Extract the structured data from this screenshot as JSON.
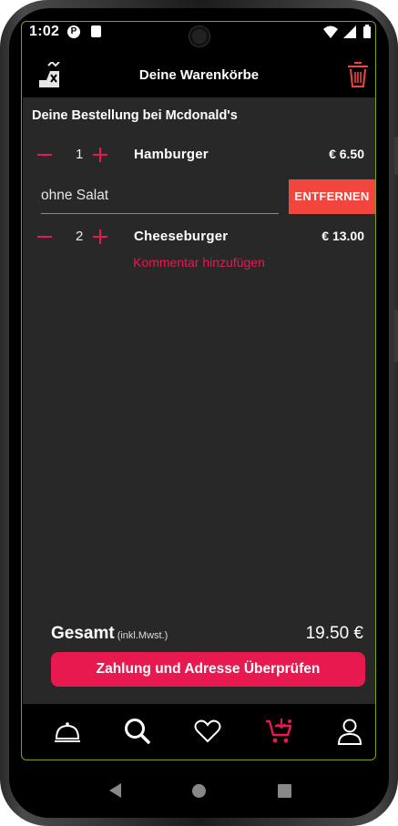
{
  "status_bar": {
    "time": "1:02"
  },
  "header": {
    "title": "Deine Warenkörbe"
  },
  "order": {
    "restaurant_title": "Deine Bestellung bei Mcdonald's",
    "items": [
      {
        "quantity": "1",
        "name": "Hamburger",
        "price": "€ 6.50",
        "comment": "ohne Salat",
        "remove_label": "ENTFERNEN"
      },
      {
        "quantity": "2",
        "name": "Cheeseburger",
        "price": "€ 13.00",
        "add_comment_label": "Kommentar hinzufügen"
      }
    ]
  },
  "total": {
    "label": "Gesamt",
    "sublabel": "(inkl.Mwst.)",
    "amount": "19.50 €"
  },
  "pay_button": {
    "label": "Zahlung und Adresse Überprüfen"
  },
  "bottom_nav": {
    "items": [
      {
        "icon": "restaurant-cloche-icon",
        "active": false
      },
      {
        "icon": "search-icon",
        "active": false
      },
      {
        "icon": "heart-icon",
        "active": false
      },
      {
        "icon": "cart-icon",
        "active": true
      },
      {
        "icon": "user-icon",
        "active": false
      }
    ]
  },
  "colors": {
    "accent": "#e8194f",
    "remove": "#f2453d",
    "surface": "#282828",
    "bar": "#000000"
  }
}
